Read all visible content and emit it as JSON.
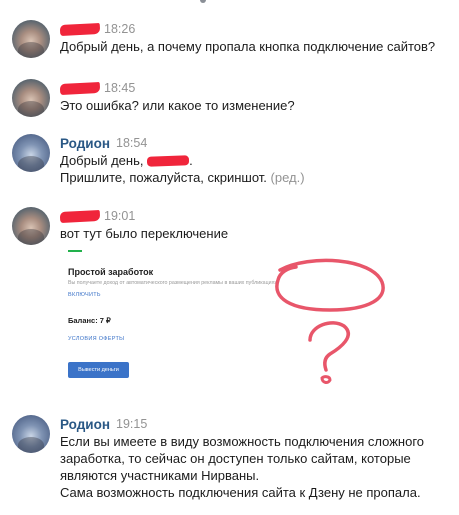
{
  "messages": [
    {
      "author": "",
      "time": "18:26",
      "lines": [
        "Добрый день, а почему пропала кнопка подключение сайтов?"
      ]
    },
    {
      "author": "",
      "time": "18:45",
      "lines": [
        "Это ошибка? или какое то изменение?"
      ]
    },
    {
      "author": "Родион",
      "time": "18:54",
      "line1": "Добрый день,",
      "line1_end": ".",
      "line2": "Пришлите, пожалуйста, скриншот.",
      "edited": "(ред.)"
    },
    {
      "author": "",
      "time": "19:01",
      "lines": [
        "вот тут было переключение"
      ]
    },
    {
      "author": "Родион",
      "time": "19:15",
      "lines": [
        "Если вы имеете в виду возможность подключения сложного",
        "заработка, то сейчас он доступен только сайтам, которые",
        "являются участниками Нирваны.",
        "Сама возможность подключения сайта к Дзену не пропала."
      ]
    }
  ],
  "attachment": {
    "title": "Простой заработок",
    "description": "Вы получаете доход от автоматического размещения рекламы в ваших публикациях",
    "enable_link": "ВКЛЮЧИТЬ",
    "balance": "Баланс: 7 ₽",
    "offer_link": "УСЛОВИЯ ОФЕРТЫ",
    "withdraw_button": "Вывести деньги",
    "accent_color": "#22b14c",
    "link_color": "#3b73c8"
  },
  "colors": {
    "author_name": "#2a5885",
    "timestamp": "#939393",
    "redaction": "#f0253b",
    "annotation": "#e8566a"
  }
}
